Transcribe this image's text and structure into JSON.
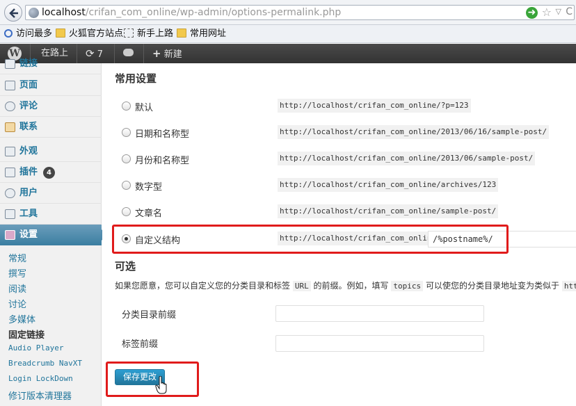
{
  "browser": {
    "url_host": "localhost",
    "url_path": "/crifan_com_online/wp-admin/options-permalink.php",
    "bookmarks": [
      "访问最多",
      "火狐官方站点",
      "新手上路",
      "常用网址"
    ]
  },
  "adminbar": {
    "site_name": "在路上",
    "updates_count": "7",
    "new_label": "新建"
  },
  "sidebar": {
    "items": [
      {
        "label": "链接"
      },
      {
        "label": "页面"
      },
      {
        "label": "评论"
      },
      {
        "label": "联系"
      },
      {
        "label": "外观"
      },
      {
        "label": "插件",
        "badge": "4"
      },
      {
        "label": "用户"
      },
      {
        "label": "工具"
      },
      {
        "label": "设置"
      }
    ],
    "submenu": [
      "常规",
      "撰写",
      "阅读",
      "讨论",
      "多媒体",
      "固定链接",
      "Audio Player",
      "Breadcrumb NavXT",
      "Login LockDown",
      "修订版本清理器"
    ]
  },
  "main": {
    "common_title": "常用设置",
    "options": [
      {
        "label": "默认",
        "code": "http://localhost/crifan_com_online/?p=123"
      },
      {
        "label": "日期和名称型",
        "code": "http://localhost/crifan_com_online/2013/06/16/sample-post/"
      },
      {
        "label": "月份和名称型",
        "code": "http://localhost/crifan_com_online/2013/06/sample-post/"
      },
      {
        "label": "数字型",
        "code": "http://localhost/crifan_com_online/archives/123"
      },
      {
        "label": "文章名",
        "code": "http://localhost/crifan_com_online/sample-post/"
      },
      {
        "label": "自定义结构",
        "code": "http://localhost/crifan_com_online"
      }
    ],
    "custom_structure_value": "/%postname%/",
    "optional_title": "可选",
    "desc_before": "如果您愿意，您可以自定义您的分类目录和标签",
    "desc_url": "URL",
    "desc_middle": "的前缀。例如，填写",
    "desc_topics": "topics",
    "desc_after": "可以使您的分类目录地址变为类似于",
    "desc_tail": "htt",
    "category_base_label": "分类目录前缀",
    "tag_base_label": "标签前缀",
    "save_label": "保存更改"
  }
}
